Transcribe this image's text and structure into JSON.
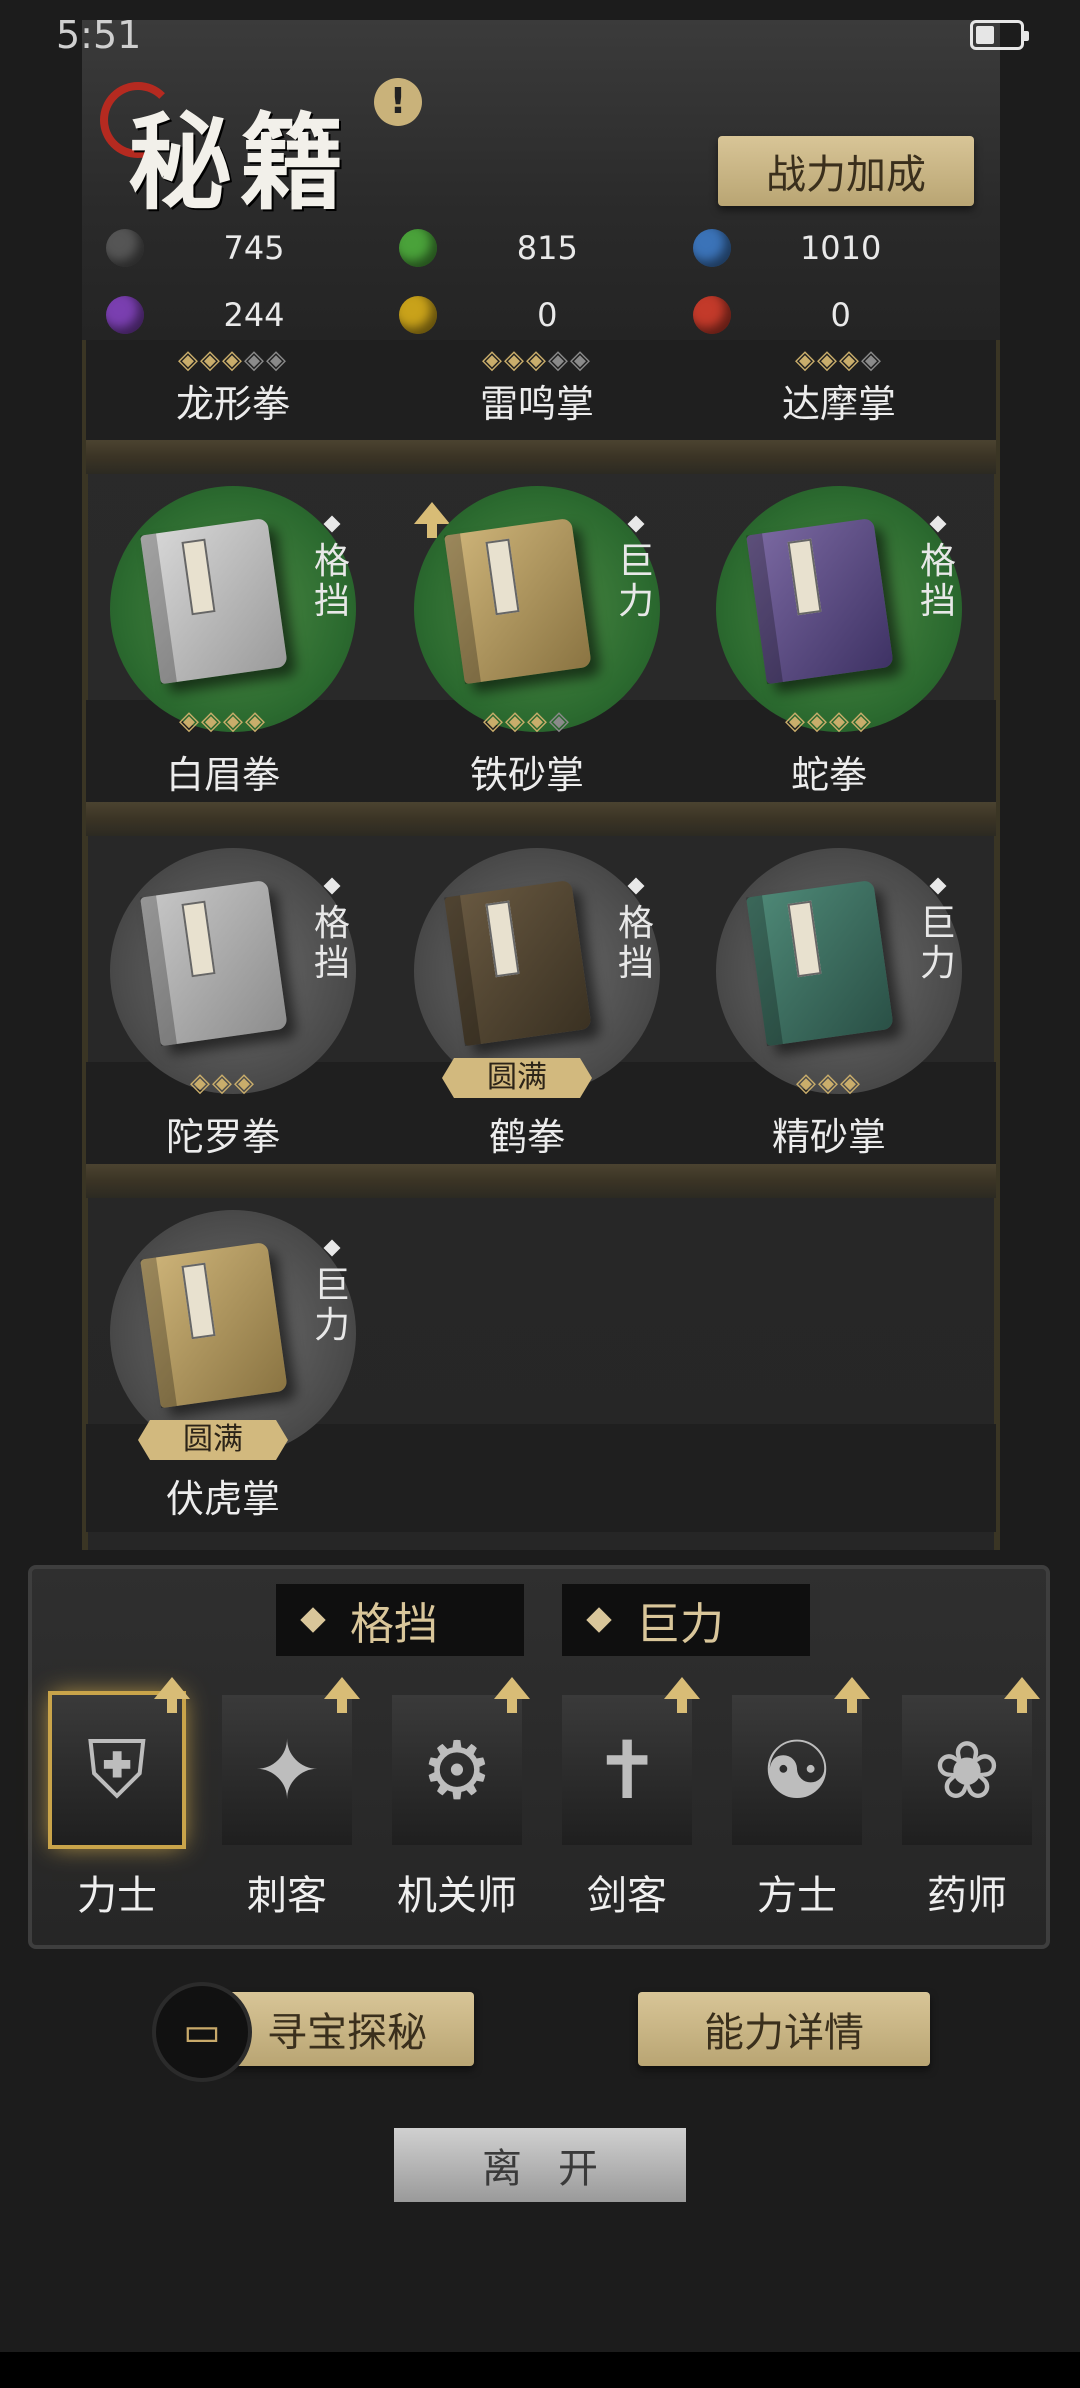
{
  "status": {
    "time": "5:51"
  },
  "header": {
    "title": "秘籍",
    "alert_glyph": "!",
    "power_button": "战力加成"
  },
  "resources": [
    {
      "color": "#555555",
      "value": "745"
    },
    {
      "color": "#4aa23a",
      "value": "815"
    },
    {
      "color": "#3b73b8",
      "value": "1010"
    },
    {
      "color": "#7a3fb0",
      "value": "244"
    },
    {
      "color": "#c9a21a",
      "value": "0"
    },
    {
      "color": "#c33a2a",
      "value": "0"
    }
  ],
  "partial_row": [
    {
      "name": "龙形拳",
      "stars": "◈◈◈",
      "stars_dim": "◈◈"
    },
    {
      "name": "雷鸣掌",
      "stars": "◈◈◈",
      "stars_dim": "◈◈"
    },
    {
      "name": "达摩掌",
      "stars": "◈◈◈",
      "stars_dim": "◈"
    }
  ],
  "books": [
    {
      "name": "白眉拳",
      "tag": "格挡",
      "stars": "◈◈◈◈",
      "stars_dim": ""
    },
    {
      "name": "铁砂掌",
      "tag": "巨力",
      "stars": "◈◈◈",
      "stars_dim": "◈"
    },
    {
      "name": "蛇拳",
      "tag": "格挡",
      "stars": "◈◈◈◈",
      "stars_dim": ""
    },
    {
      "name": "陀罗拳",
      "tag": "格挡",
      "stars": "◈◈◈",
      "stars_dim": ""
    },
    {
      "name": "鹤拳",
      "tag": "格挡",
      "badge": "圆满"
    },
    {
      "name": "精砂掌",
      "tag": "巨力",
      "stars": "◈◈◈",
      "stars_dim": ""
    },
    {
      "name": "伏虎掌",
      "tag": "巨力",
      "badge": "圆满"
    }
  ],
  "filters": [
    "格挡",
    "巨力"
  ],
  "classes": [
    {
      "label": "力士",
      "glyph": "⛨"
    },
    {
      "label": "刺客",
      "glyph": "✦"
    },
    {
      "label": "机关师",
      "glyph": "⚙"
    },
    {
      "label": "剑客",
      "glyph": "✝"
    },
    {
      "label": "方士",
      "glyph": "☯"
    },
    {
      "label": "药师",
      "glyph": "❀"
    }
  ],
  "buttons": {
    "treasure": "寻宝探秘",
    "ability": "能力详情",
    "leave": "离开"
  },
  "colors": {
    "accent": "#d2b97e",
    "panel": "#2a2a2a"
  }
}
